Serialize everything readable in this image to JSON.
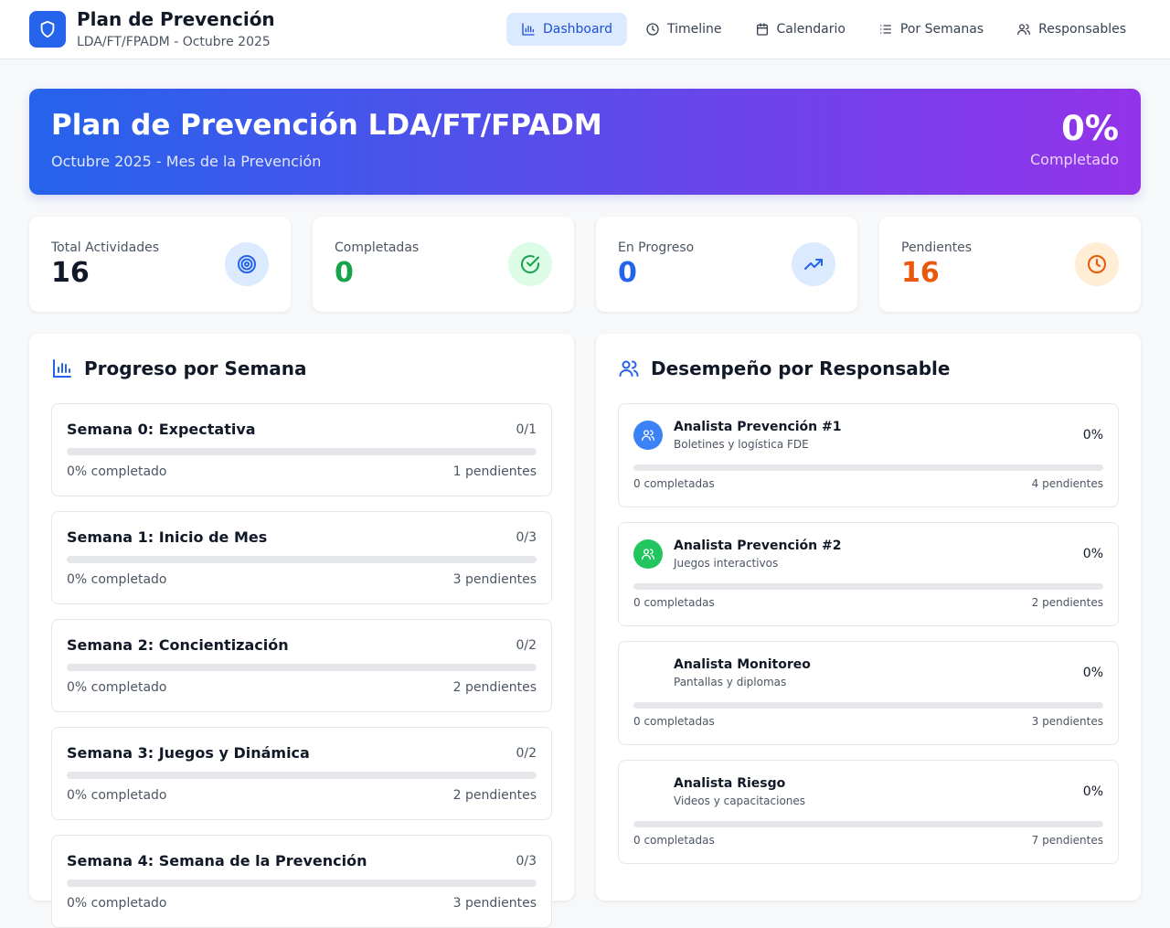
{
  "header": {
    "title": "Plan de Prevención",
    "subtitle": "LDA/FT/FPADM - Octubre 2025",
    "logo_icon": "shield-icon",
    "nav": [
      {
        "label": "Dashboard",
        "icon": "bar-chart-icon",
        "active": true
      },
      {
        "label": "Timeline",
        "icon": "clock-icon",
        "active": false
      },
      {
        "label": "Calendario",
        "icon": "calendar-icon",
        "active": false
      },
      {
        "label": "Por Semanas",
        "icon": "list-icon",
        "active": false
      },
      {
        "label": "Responsables",
        "icon": "users-icon",
        "active": false
      }
    ]
  },
  "hero": {
    "title": "Plan de Prevención LDA/FT/FPADM",
    "subtitle": "Octubre 2025 - Mes de la Prevención",
    "percent": "0%",
    "percent_label": "Completado"
  },
  "stats": [
    {
      "label": "Total Actividades",
      "value": "16",
      "color": "#111827",
      "icon": "target-icon",
      "icon_bg": "#dbeafe",
      "icon_color": "#2563eb"
    },
    {
      "label": "Completadas",
      "value": "0",
      "color": "#16a34a",
      "icon": "check-circle-icon",
      "icon_bg": "#dcfce7",
      "icon_color": "#16a34a"
    },
    {
      "label": "En Progreso",
      "value": "0",
      "color": "#2563eb",
      "icon": "trending-up-icon",
      "icon_bg": "#dbeafe",
      "icon_color": "#2563eb"
    },
    {
      "label": "Pendientes",
      "value": "16",
      "color": "#ea580c",
      "icon": "clock-icon",
      "icon_bg": "#ffedd5",
      "icon_color": "#ea580c"
    }
  ],
  "weeks_panel": {
    "title": "Progreso por Semana",
    "icon": "bar-chart-icon",
    "weeks": [
      {
        "name": "Semana 0: Expectativa",
        "ratio": "0/1",
        "progress": 0,
        "percent_text": "0% completado",
        "pending_text": "1 pendientes"
      },
      {
        "name": "Semana 1: Inicio de Mes",
        "ratio": "0/3",
        "progress": 0,
        "percent_text": "0% completado",
        "pending_text": "3 pendientes"
      },
      {
        "name": "Semana 2: Concientización",
        "ratio": "0/2",
        "progress": 0,
        "percent_text": "0% completado",
        "pending_text": "2 pendientes"
      },
      {
        "name": "Semana 3: Juegos y Dinámica",
        "ratio": "0/2",
        "progress": 0,
        "percent_text": "0% completado",
        "pending_text": "2 pendientes"
      },
      {
        "name": "Semana 4: Semana de la Prevención",
        "ratio": "0/3",
        "progress": 0,
        "percent_text": "0% completado",
        "pending_text": "3 pendientes"
      }
    ]
  },
  "responsables_panel": {
    "title": "Desempeño por Responsable",
    "icon": "users-icon",
    "items": [
      {
        "name": "Analista Prevención #1",
        "role": "Boletines y logística FDE",
        "percent": "0%",
        "progress": 0,
        "completed_text": "0 completadas",
        "pending_text": "4 pendientes",
        "avatar_color": "#3b82f6",
        "avatar_icon": "users-icon"
      },
      {
        "name": "Analista Prevención #2",
        "role": "Juegos interactivos",
        "percent": "0%",
        "progress": 0,
        "completed_text": "0 completadas",
        "pending_text": "2 pendientes",
        "avatar_color": "#22c55e",
        "avatar_icon": "users-icon"
      },
      {
        "name": "Analista Monitoreo",
        "role": "Pantallas y diplomas",
        "percent": "0%",
        "progress": 0,
        "completed_text": "0 completadas",
        "pending_text": "3 pendientes",
        "avatar_color": "#ffffff",
        "avatar_icon": ""
      },
      {
        "name": "Analista Riesgo",
        "role": "Videos y capacitaciones",
        "percent": "0%",
        "progress": 0,
        "completed_text": "0 completadas",
        "pending_text": "7 pendientes",
        "avatar_color": "#ffffff",
        "avatar_icon": ""
      }
    ]
  }
}
